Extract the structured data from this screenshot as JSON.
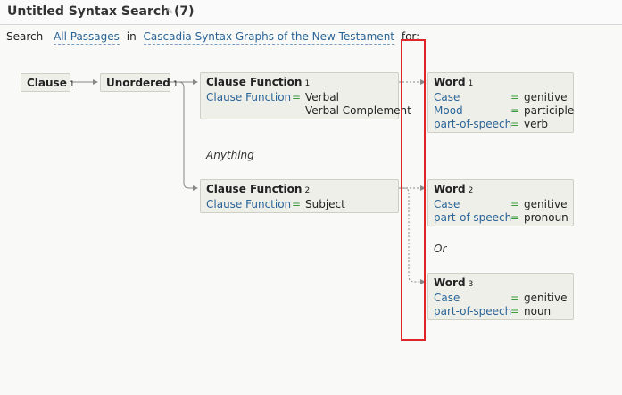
{
  "header": {
    "title": "Untitled Syntax Search (7)"
  },
  "search": {
    "prefix": "Search",
    "scope": "All Passages",
    "in_word": "in",
    "database": "Cascadia Syntax Graphs of the New Testament",
    "for_word": "for:"
  },
  "nodes": {
    "clause": {
      "label": "Clause",
      "num": "1"
    },
    "unordered": {
      "label": "Unordered",
      "num": "1"
    },
    "cf1": {
      "label": "Clause Function",
      "num": "1",
      "key": "Clause Function",
      "eq": "=",
      "val1": "Verbal",
      "val2": "Verbal Complement"
    },
    "cf2": {
      "label": "Clause Function",
      "num": "2",
      "key": "Clause Function",
      "eq": "=",
      "val1": "Subject"
    },
    "word1": {
      "label": "Word",
      "num": "1",
      "rows": [
        {
          "key": "Case",
          "eq": "=",
          "val": "genitive"
        },
        {
          "key": "Mood",
          "eq": "=",
          "val": "participle"
        },
        {
          "key": "part-of-speech",
          "eq": "=",
          "val": "verb"
        }
      ]
    },
    "word2": {
      "label": "Word",
      "num": "2",
      "rows": [
        {
          "key": "Case",
          "eq": "=",
          "val": "genitive"
        },
        {
          "key": "part-of-speech",
          "eq": "=",
          "val": "pronoun"
        }
      ]
    },
    "word3": {
      "label": "Word",
      "num": "3",
      "rows": [
        {
          "key": "Case",
          "eq": "=",
          "val": "genitive"
        },
        {
          "key": "part-of-speech",
          "eq": "=",
          "val": "noun"
        }
      ]
    }
  },
  "connectors": {
    "anything": "Anything",
    "or": "Or"
  },
  "colors": {
    "highlight": "#e0242a",
    "link": "#2a6496",
    "equals": "#3d9a3d"
  }
}
